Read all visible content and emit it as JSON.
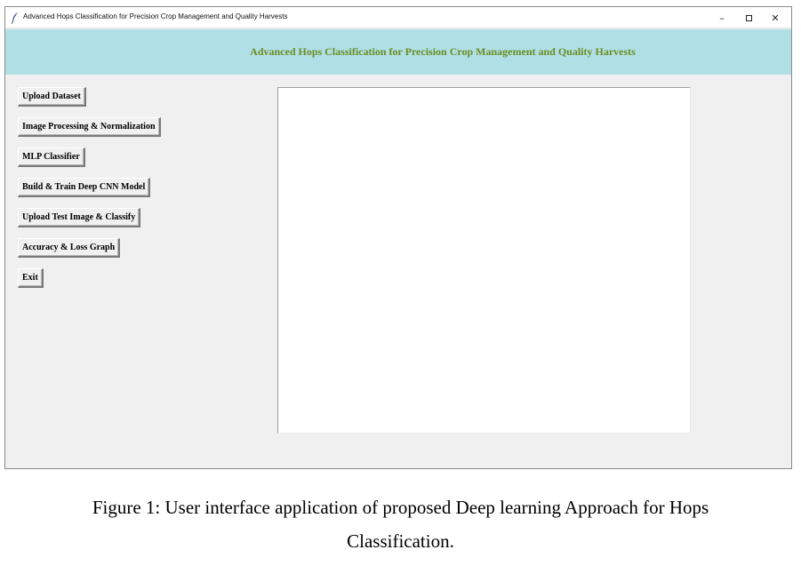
{
  "window": {
    "title": "Advanced Hops Classification for Precision Crop Management and Quality Harvests",
    "controls": {
      "minimize": "–",
      "close": "✕"
    }
  },
  "header": {
    "title": "Advanced Hops Classification for Precision Crop Management and Quality Harvests",
    "background_color": "#b0dfe5",
    "title_color": "#6b8e23"
  },
  "buttons": [
    "Upload Dataset",
    "Image Processing & Normalization",
    "MLP Classifier",
    "Build & Train Deep CNN Model",
    "Upload Test Image & Classify",
    "Accuracy & Loss Graph",
    "Exit"
  ],
  "output": {
    "text": ""
  },
  "caption": {
    "line1": "Figure 1: User interface application of proposed Deep learning Approach for Hops",
    "line2": "Classification."
  }
}
